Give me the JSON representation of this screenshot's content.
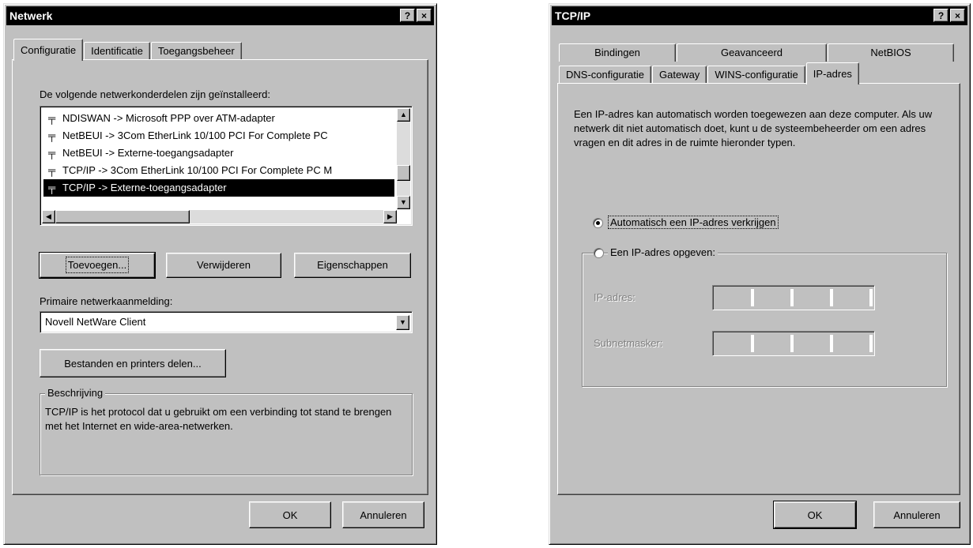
{
  "network": {
    "title": "Netwerk",
    "help_button": "?",
    "close_button": "×",
    "tabs": [
      "Configuratie",
      "Identificatie",
      "Toegangsbeheer"
    ],
    "components_label": "De volgende netwerkonderdelen zijn geïnstalleerd:",
    "components": [
      "NDISWAN -> Microsoft PPP over ATM-adapter",
      "NetBEUI -> 3Com EtherLink 10/100 PCI For Complete PC",
      "NetBEUI -> Externe-toegangsadapter",
      "TCP/IP -> 3Com EtherLink 10/100 PCI For Complete PC M",
      "TCP/IP -> Externe-toegangsadapter"
    ],
    "add_button": "Toevoegen...",
    "remove_button": "Verwijderen",
    "properties_button": "Eigenschappen",
    "primary_logon_label": "Primaire netwerkaanmelding:",
    "primary_logon_value": "Novell NetWare Client",
    "file_sharing_button": "Bestanden en printers delen...",
    "description_legend": "Beschrijving",
    "description_text": "TCP/IP is het protocol dat u gebruikt om een verbinding tot stand te brengen met het Internet en wide-area-netwerken.",
    "ok_button": "OK",
    "cancel_button": "Annuleren"
  },
  "tcpip": {
    "title": "TCP/IP",
    "help_button": "?",
    "close_button": "×",
    "tabs_back": [
      "Bindingen",
      "Geavanceerd",
      "NetBIOS"
    ],
    "tabs_front": [
      "DNS-configuratie",
      "Gateway",
      "WINS-configuratie",
      "IP-adres"
    ],
    "info_text": "Een IP-adres kan automatisch worden toegewezen aan deze computer. Als uw netwerk dit niet automatisch doet, kunt u de systeembeheerder om een adres vragen en dit adres in de ruimte hieronder typen.",
    "radio_auto": "Automatisch een IP-adres verkrijgen",
    "radio_manual": "Een IP-adres opgeven:",
    "ip_label": "IP-adres:",
    "subnet_label": "Subnetmasker:",
    "ok_button": "OK",
    "cancel_button": "Annuleren"
  }
}
